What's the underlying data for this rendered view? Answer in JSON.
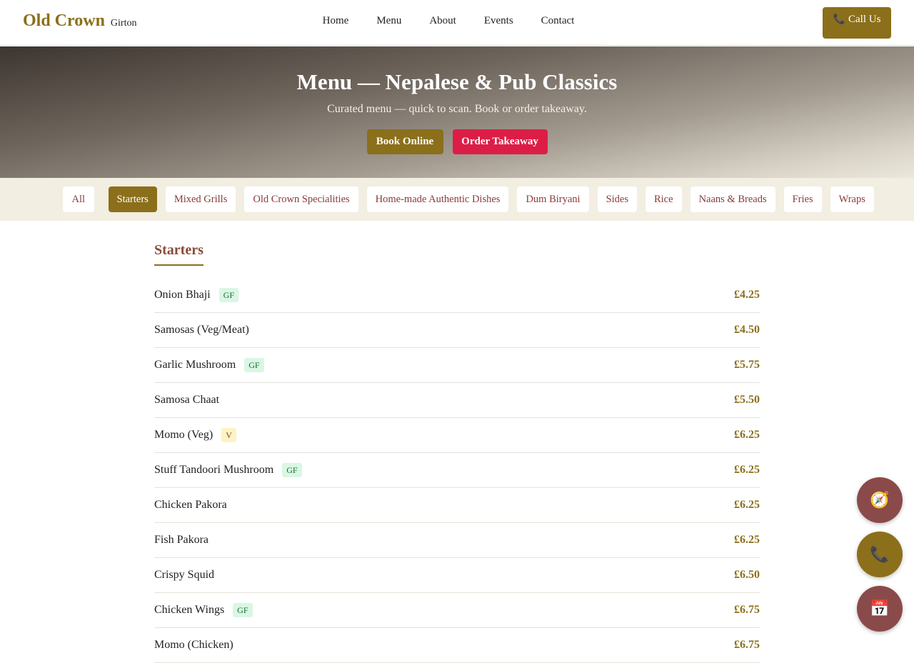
{
  "header": {
    "brand": "Old Crown",
    "location": "Girton",
    "nav": [
      "Home",
      "Menu",
      "About",
      "Events",
      "Contact"
    ],
    "call_label": "Call Us",
    "call_icon": "phone-icon"
  },
  "hero": {
    "title": "Menu — Nepalese & Pub Classics",
    "subtitle": "Curated menu — quick to scan. Book or order takeaway.",
    "book_label": "Book Online",
    "order_label": "Order Takeaway"
  },
  "categories": {
    "items": [
      "All",
      "Starters",
      "Mixed Grills",
      "Old Crown Specialities",
      "Home-made Authentic Dishes",
      "Dum Biryani",
      "Sides",
      "Rice",
      "Naans & Breads",
      "Fries",
      "Wraps"
    ],
    "active": "Starters"
  },
  "menu": {
    "section_title": "Starters",
    "items": [
      {
        "name": "Onion Bhaji",
        "tag": "GF",
        "price": "£4.25"
      },
      {
        "name": "Samosas (Veg/Meat)",
        "tag": "",
        "price": "£4.50"
      },
      {
        "name": "Garlic Mushroom",
        "tag": "GF",
        "price": "£5.75"
      },
      {
        "name": "Samosa Chaat",
        "tag": "",
        "price": "£5.50"
      },
      {
        "name": "Momo (Veg)",
        "tag": "V",
        "price": "£6.25"
      },
      {
        "name": "Stuff Tandoori Mushroom",
        "tag": "GF",
        "price": "£6.25"
      },
      {
        "name": "Chicken Pakora",
        "tag": "",
        "price": "£6.25"
      },
      {
        "name": "Fish Pakora",
        "tag": "",
        "price": "£6.25"
      },
      {
        "name": "Crispy Squid",
        "tag": "",
        "price": "£6.50"
      },
      {
        "name": "Chicken Wings",
        "tag": "GF",
        "price": "£6.75"
      },
      {
        "name": "Momo (Chicken)",
        "tag": "",
        "price": "£6.75"
      }
    ]
  },
  "floating": {
    "directions_icon": "compass-icon",
    "phone_icon": "phone-icon",
    "calendar_icon": "calendar-icon"
  },
  "colors": {
    "brand_gold": "#8b6f1a",
    "accent_red": "#dc1e46",
    "maroon": "#8b4a4a"
  }
}
